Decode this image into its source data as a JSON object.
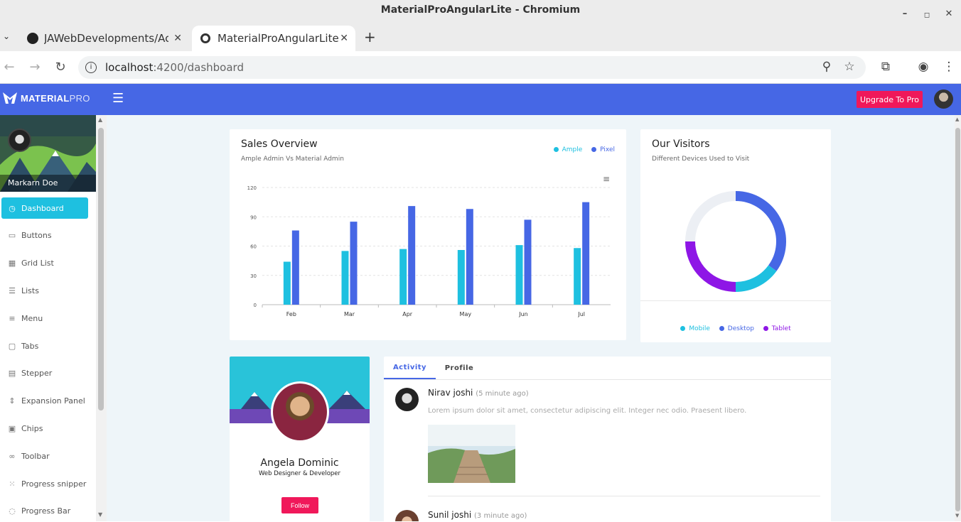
{
  "window": {
    "title": "MaterialProAngularLite - Chromium"
  },
  "browser": {
    "tabs": [
      {
        "label": "JAWebDevelopments/Ac",
        "active": false
      },
      {
        "label": "MaterialProAngularLite",
        "active": true
      }
    ],
    "url_host": "localhost",
    "url_path": ":4200/dashboard"
  },
  "app": {
    "brand_bold": "MATERIAL",
    "brand_light": "PRO",
    "upgrade_label": "Upgrade To Pro",
    "colors": {
      "primary": "#4667e5",
      "accent": "#f0185a",
      "cyan": "#1ec0e0",
      "purple": "#8e16e6",
      "grey": "#eceff4"
    }
  },
  "sidebar": {
    "user_name": "Markarn Doe",
    "items": [
      {
        "label": "Dashboard",
        "icon": "dashboard-icon",
        "glyph": "◷",
        "active": true
      },
      {
        "label": "Buttons",
        "icon": "button-icon",
        "glyph": "▭",
        "active": false
      },
      {
        "label": "Grid List",
        "icon": "grid-icon",
        "glyph": "▦",
        "active": false
      },
      {
        "label": "Lists",
        "icon": "list-icon",
        "glyph": "☰",
        "active": false
      },
      {
        "label": "Menu",
        "icon": "menu-icon",
        "glyph": "≡",
        "active": false
      },
      {
        "label": "Tabs",
        "icon": "tab-icon",
        "glyph": "▢",
        "active": false
      },
      {
        "label": "Stepper",
        "icon": "stepper-icon",
        "glyph": "▤",
        "active": false
      },
      {
        "label": "Expansion Panel",
        "icon": "expansion-icon",
        "glyph": "⇕",
        "active": false
      },
      {
        "label": "Chips",
        "icon": "chip-icon",
        "glyph": "▣",
        "active": false
      },
      {
        "label": "Toolbar",
        "icon": "toolbar-icon",
        "glyph": "∞",
        "active": false
      },
      {
        "label": "Progress snipper",
        "icon": "spinner-icon",
        "glyph": "⁙",
        "active": false
      },
      {
        "label": "Progress Bar",
        "icon": "progress-icon",
        "glyph": "◌",
        "active": false
      }
    ]
  },
  "sales": {
    "title": "Sales Overview",
    "subtitle": "Ample Admin Vs Material Admin",
    "legend": [
      {
        "name": "Ample",
        "color": "#1ec0e0"
      },
      {
        "name": "Pixel",
        "color": "#4667e5"
      }
    ]
  },
  "chart_data": {
    "type": "bar",
    "title": "Sales Overview",
    "categories": [
      "Feb",
      "Mar",
      "Apr",
      "May",
      "Jun",
      "Jul"
    ],
    "series": [
      {
        "name": "Ample",
        "color": "#1ec0e0",
        "values": [
          44,
          55,
          57,
          56,
          61,
          58
        ]
      },
      {
        "name": "Pixel",
        "color": "#4667e5",
        "values": [
          76,
          85,
          101,
          98,
          87,
          105
        ]
      }
    ],
    "yticks": [
      0,
      30,
      60,
      90,
      120
    ],
    "ylim": [
      0,
      120
    ],
    "grid": true,
    "legend_position": "top-right"
  },
  "visitors": {
    "title": "Our Visitors",
    "subtitle": "Different Devices Used to Visit",
    "legend": [
      {
        "name": "Mobile",
        "color": "#1ec0e0"
      },
      {
        "name": "Desktop",
        "color": "#4667e5"
      },
      {
        "name": "Tablet",
        "color": "#8e16e6"
      }
    ],
    "donut": {
      "type": "pie",
      "slices": [
        {
          "name": "Desktop",
          "value": 35,
          "color": "#4667e5"
        },
        {
          "name": "Mobile",
          "value": 15,
          "color": "#1ec0e0"
        },
        {
          "name": "Tablet",
          "value": 25,
          "color": "#8e16e6"
        },
        {
          "name": "Other",
          "value": 25,
          "color": "#eceff4"
        }
      ]
    }
  },
  "profile": {
    "name": "Angela Dominic",
    "role": "Web Designer & Developer",
    "follow_label": "Follow"
  },
  "activity": {
    "tabs": [
      "Activity",
      "Profile"
    ],
    "entries": [
      {
        "name": "Nirav joshi",
        "time": "(5 minute ago)",
        "text": "Lorem ipsum dolor sit amet, consectetur adipiscing elit. Integer nec odio. Praesent libero."
      },
      {
        "name": "Sunil joshi",
        "time": "(3 minute ago)"
      }
    ]
  }
}
